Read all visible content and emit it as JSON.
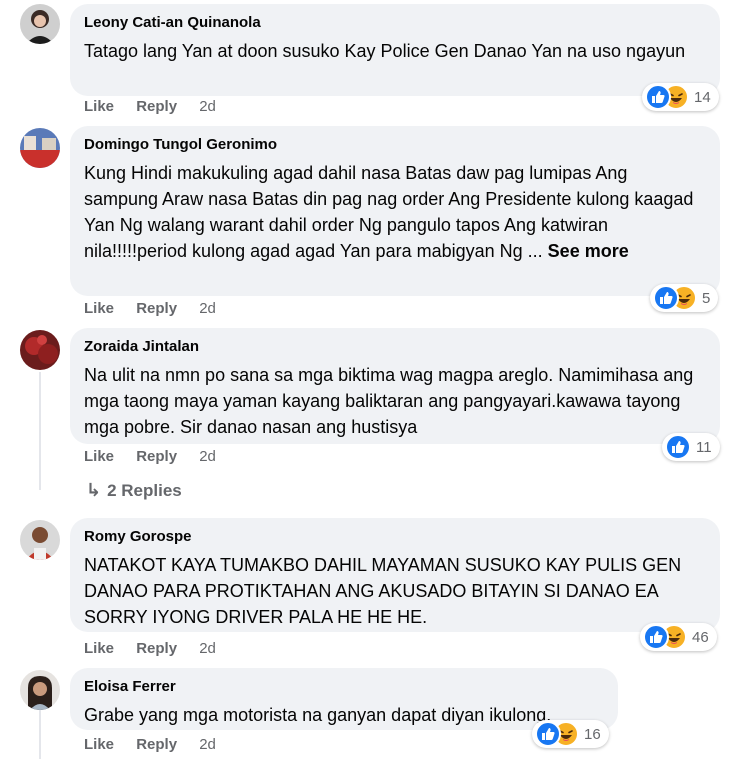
{
  "comments": [
    {
      "author": "Leony Cati-an Quinanola",
      "text": "Tatago lang Yan at doon susuko Kay Police Gen Danao Yan na uso ngayun",
      "see_more": "",
      "like": "Like",
      "reply": "Reply",
      "time": "2d",
      "reactions": "14"
    },
    {
      "author": "Domingo Tungol Geronimo",
      "text": "Kung Hindi makukuling agad dahil nasa Batas daw pag lumipas Ang sampung Araw nasa Batas din pag nag order Ang Presidente kulong kaagad Yan Ng walang warant dahil order Ng pangulo tapos Ang katwiran nila!!!!!period kulong agad agad Yan para mabigyan Ng ...",
      "see_more": "See more",
      "like": "Like",
      "reply": "Reply",
      "time": "2d",
      "reactions": "5"
    },
    {
      "author": "Zoraida Jintalan",
      "text": "Na ulit na nmn po sana sa mga biktima wag magpa areglo. Namimihasa ang mga taong maya yaman kayang baliktaran ang pangyayari.kawawa tayong mga pobre. Sir danao nasan ang hustisya",
      "see_more": "",
      "like": "Like",
      "reply": "Reply",
      "time": "2d",
      "reactions": "11"
    },
    {
      "author": "Romy Gorospe",
      "text": "NATAKOT KAYA TUMAKBO DAHIL MAYAMAN SUSUKO KAY PULIS GEN DANAO PARA PROTIKTAHAN ANG AKUSADO BITAYIN SI DANAO EA SORRY IYONG DRIVER PALA HE HE HE.",
      "see_more": "",
      "like": "Like",
      "reply": "Reply",
      "time": "2d",
      "reactions": "46"
    },
    {
      "author": "Eloisa Ferrer",
      "text": "Grabe yang mga motorista na ganyan dapat diyan ikulong.",
      "see_more": "",
      "like": "Like",
      "reply": "Reply",
      "time": "2d",
      "reactions": "16"
    }
  ],
  "replies_link": "2 Replies",
  "colors": {
    "bubble": "#f0f2f5",
    "like_blue": "#1877f2",
    "haha_yellow": "#f7b125",
    "meta_gray": "#65676b"
  }
}
